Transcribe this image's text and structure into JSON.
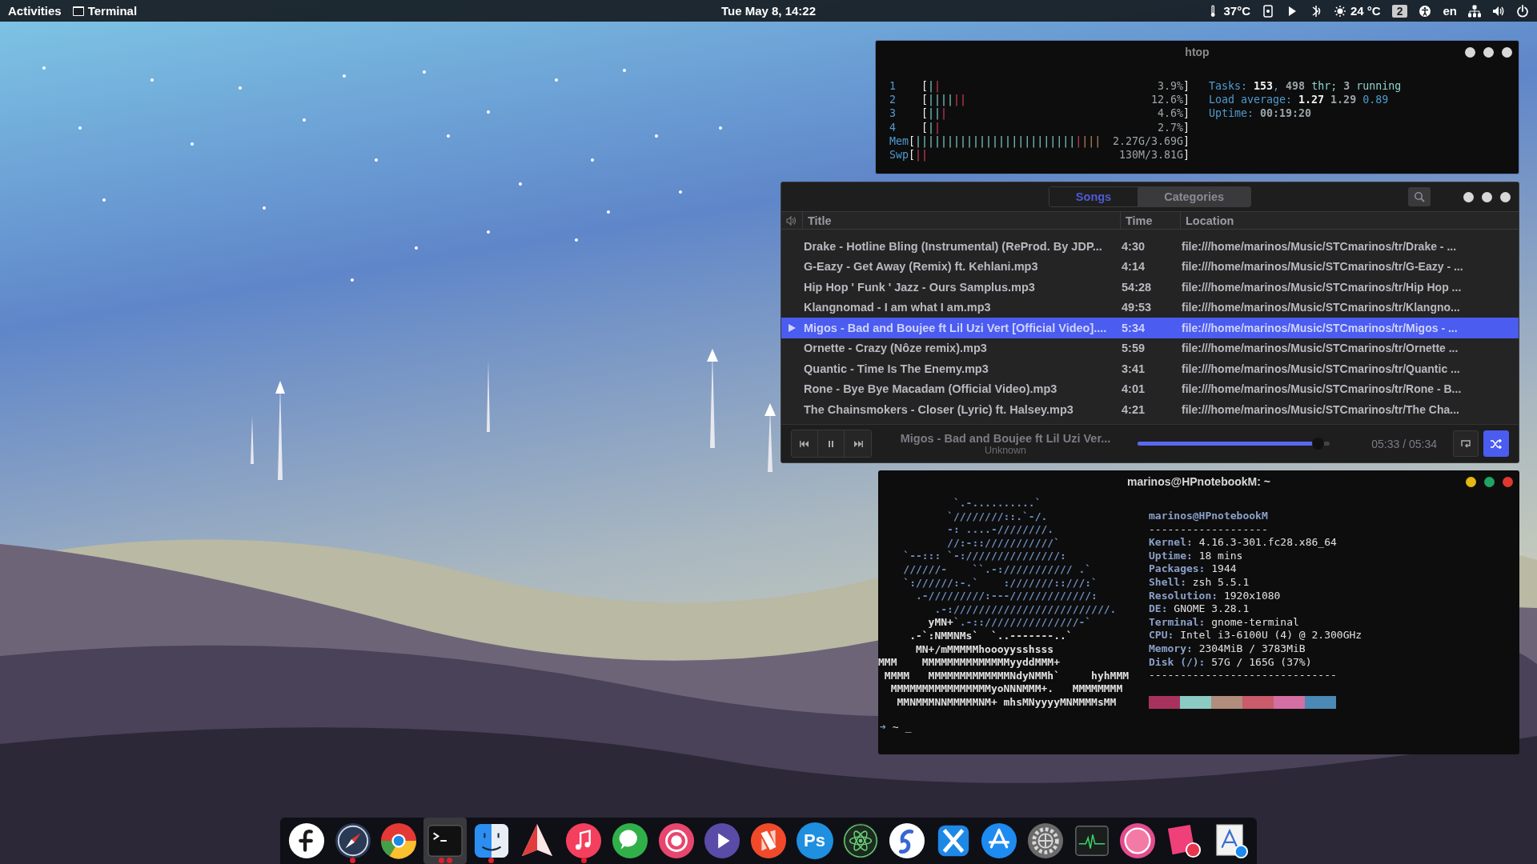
{
  "top_bar": {
    "activities": "Activities",
    "app_menu": "Terminal",
    "clock": "Tue May 8, 14:22",
    "indicators": [
      {
        "kind": "thermometer",
        "text": "37°C"
      },
      {
        "kind": "phone"
      },
      {
        "kind": "play"
      },
      {
        "kind": "signal"
      },
      {
        "kind": "weather",
        "text": "24 °C"
      },
      {
        "kind": "workspace",
        "text": "2"
      },
      {
        "kind": "accessibility"
      },
      {
        "kind": "language",
        "text": "en"
      },
      {
        "kind": "network"
      },
      {
        "kind": "volume"
      },
      {
        "kind": "power"
      }
    ]
  },
  "htop": {
    "title": "htop",
    "controls": [
      {
        "color": "#d8d8d8"
      },
      {
        "color": "#d8d8d8"
      },
      {
        "color": "#d8d8d8"
      }
    ],
    "meters": [
      {
        "label": "1",
        "open": "[",
        "bars": [
          {
            "kind": "normal",
            "text": "|"
          },
          {
            "kind": "kernel",
            "text": "|"
          }
        ],
        "value": "3.9%",
        "close": "]"
      },
      {
        "label": "2",
        "open": "[",
        "bars": [
          {
            "kind": "normal",
            "text": "||||"
          },
          {
            "kind": "kernel",
            "text": "||"
          }
        ],
        "value": "12.6%",
        "close": "]"
      },
      {
        "label": "3",
        "open": "[",
        "bars": [
          {
            "kind": "normal",
            "text": "||"
          },
          {
            "kind": "kernel",
            "text": "|"
          }
        ],
        "value": "4.6%",
        "close": "]"
      },
      {
        "label": "4",
        "open": "[",
        "bars": [
          {
            "kind": "normal",
            "text": "|"
          },
          {
            "kind": "kernel",
            "text": "|"
          }
        ],
        "value": "2.7%",
        "close": "]"
      },
      {
        "label": "Mem",
        "open": "[",
        "bars": [
          {
            "kind": "normal",
            "text": "|||||||||||||||||||||||||"
          },
          {
            "kind": "kernel",
            "text": "|"
          },
          {
            "kind": "cache",
            "text": "|||"
          }
        ],
        "value": "2.27G/3.69G",
        "close": "]"
      },
      {
        "label": "Swp",
        "open": "[",
        "bars": [
          {
            "kind": "kernel",
            "text": "||"
          }
        ],
        "value": "130M/3.81G",
        "close": "]"
      }
    ],
    "summary": [
      [
        {
          "kind": "label",
          "text": "Tasks: "
        },
        {
          "kind": "bright",
          "text": "153"
        },
        {
          "kind": "label",
          "text": ", "
        },
        {
          "kind": "dim",
          "text": "498"
        },
        {
          "kind": "accent",
          "text": " thr; "
        },
        {
          "kind": "dim",
          "text": "3"
        },
        {
          "kind": "accent",
          "text": " running"
        }
      ],
      [
        {
          "kind": "label",
          "text": "Load average: "
        },
        {
          "kind": "bright",
          "text": "1.27 "
        },
        {
          "kind": "dim",
          "text": "1.29 "
        },
        {
          "kind": "label",
          "text": "0.89"
        }
      ],
      [
        {
          "kind": "label",
          "text": "Uptime: "
        },
        {
          "kind": "dim",
          "text": "00:19:20"
        }
      ]
    ]
  },
  "music": {
    "tabs": [
      {
        "label": "Songs",
        "selected": true
      },
      {
        "label": "Categories",
        "selected": false
      }
    ],
    "controls": [
      {
        "color": "#d8d8d8"
      },
      {
        "color": "#d8d8d8"
      },
      {
        "color": "#d8d8d8"
      }
    ],
    "columns": [
      "Title",
      "Time",
      "Location"
    ],
    "rows": [
      {
        "title": "Drake - Hotline Bling (Instrumental) (ReProd. By JDP...",
        "time": "4:30",
        "location": "file:///home/marinos/Music/STCmarinos/tr/Drake - ...",
        "selected": false
      },
      {
        "title": "G-Eazy - Get Away (Remix) ft. Kehlani.mp3",
        "time": "4:14",
        "location": "file:///home/marinos/Music/STCmarinos/tr/G-Eazy - ...",
        "selected": false
      },
      {
        "title": "Hip Hop ' Funk ' Jazz - Ours Samplus.mp3",
        "time": "54:28",
        "location": "file:///home/marinos/Music/STCmarinos/tr/Hip Hop ...",
        "selected": false
      },
      {
        "title": "Klangnomad - I am what I am.mp3",
        "time": "49:53",
        "location": "file:///home/marinos/Music/STCmarinos/tr/Klangno...",
        "selected": false
      },
      {
        "title": "Migos - Bad and Boujee ft Lil Uzi Vert [Official Video]....",
        "time": "5:34",
        "location": "file:///home/marinos/Music/STCmarinos/tr/Migos - ...",
        "selected": true
      },
      {
        "title": "Ornette - Crazy (Nôze remix).mp3",
        "time": "5:59",
        "location": "file:///home/marinos/Music/STCmarinos/tr/Ornette ...",
        "selected": false
      },
      {
        "title": "Quantic - Time Is The Enemy.mp3",
        "time": "3:41",
        "location": "file:///home/marinos/Music/STCmarinos/tr/Quantic ...",
        "selected": false
      },
      {
        "title": "Rone - Bye Bye Macadam (Official Video).mp3",
        "time": "4:01",
        "location": "file:///home/marinos/Music/STCmarinos/tr/Rone - B...",
        "selected": false
      },
      {
        "title": "The Chainsmokers - Closer (Lyric) ft. Halsey.mp3",
        "time": "4:21",
        "location": "file:///home/marinos/Music/STCmarinos/tr/The Cha...",
        "selected": false
      }
    ],
    "now_playing": {
      "title": "Migos - Bad and Boujee ft Lil Uzi Ver...",
      "artist": "Unknown",
      "level": 0.97,
      "time": "05:33 / 05:34"
    },
    "repeat": {
      "on": false
    },
    "shuffle": {
      "on": true
    }
  },
  "terminal": {
    "title": "marinos@HPnotebookM: ~",
    "controls": [
      {
        "color": "#e5b711"
      },
      {
        "color": "#1fa463"
      },
      {
        "color": "#e0382f"
      }
    ],
    "art": [
      [
        {
          "kind": "logo",
          "text": "            `.-..........`"
        }
      ],
      [
        {
          "kind": "logo",
          "text": "           `////////::.`-/."
        }
      ],
      [
        {
          "kind": "logo",
          "text": "           -: ....-////////."
        }
      ],
      [
        {
          "kind": "logo",
          "text": "           //:-::///////////`"
        }
      ],
      [
        {
          "kind": "logo",
          "text": "    `--::: `-:///////////////:"
        }
      ],
      [
        {
          "kind": "logo",
          "text": "    //////-    ``.-://///////// .`"
        }
      ],
      [
        {
          "kind": "logo",
          "text": "    `://////:-.`    :///////::///:`"
        }
      ],
      [
        {
          "kind": "logo",
          "text": "      .-/////////:---/////////////:"
        }
      ],
      [
        {
          "kind": "logo",
          "text": "         .-://///////////////////////."
        }
      ],
      [
        {
          "kind": "plain",
          "text": "        yMN+"
        },
        {
          "kind": "logo",
          "text": "`.-::///////////////-`"
        }
      ],
      [
        {
          "kind": "plain",
          "text": "     .-`:NMMNMs`  `..-------..`"
        }
      ],
      [
        {
          "kind": "plain",
          "text": "      MN+/mMMMMMhoooyysshsss"
        }
      ],
      [
        {
          "kind": "plain",
          "text": "MMM    MMMMMMMMMMMMMMyyddMMM+"
        }
      ],
      [
        {
          "kind": "plain",
          "text": " MMMM   MMMMMMMMMMMMMNdyNMMh`     hyhMMM"
        }
      ],
      [
        {
          "kind": "plain",
          "text": "  MMMMMMMMMMMMMMMMyoNNNMMM+.   MMMMMMMM"
        }
      ],
      [
        {
          "kind": "plain",
          "text": "   MMNMMMNNMMMMMNM+ mhsMNyyyyMNMMMMsMM"
        }
      ]
    ],
    "user": "marinos@HPnotebookM",
    "rule": "-------------------",
    "info": [
      {
        "key": "Kernel:",
        "value": "4.16.3-301.fc28.x86_64"
      },
      {
        "key": "Uptime:",
        "value": "18 mins"
      },
      {
        "key": "Packages:",
        "value": "1944"
      },
      {
        "key": "Shell:",
        "value": "zsh 5.5.1"
      },
      {
        "key": "Resolution:",
        "value": "1920x1080"
      },
      {
        "key": "DE:",
        "value": "GNOME 3.28.1"
      },
      {
        "key": "Terminal:",
        "value": "gnome-terminal"
      },
      {
        "key": "CPU:",
        "value": "Intel i3-6100U (4) @ 2.300GHz"
      },
      {
        "key": "Memory:",
        "value": "2304MiB / 3783MiB"
      },
      {
        "key": "Disk (/):",
        "value": "57G / 165G (37%)"
      }
    ],
    "rule2": "------------------------------",
    "palette": [
      {
        "color": "#a8325e"
      },
      {
        "color": "#8ccac4"
      },
      {
        "color": "#b08d7d"
      },
      {
        "color": "#c95b6a"
      },
      {
        "color": "#d36fa3"
      },
      {
        "color": "#4a8ab5"
      }
    ],
    "prompt": {
      "arrow": "➜",
      "path": "~",
      "cursor": "_"
    }
  },
  "dock": [
    {
      "kind": "fedora",
      "selected": false,
      "running": false,
      "multi_window": false
    },
    {
      "kind": "compass",
      "selected": false,
      "running": true,
      "multi_window": false
    },
    {
      "kind": "chrome",
      "selected": false,
      "running": false,
      "multi_window": false
    },
    {
      "kind": "terminal",
      "selected": true,
      "running": true,
      "multi_window": true
    },
    {
      "kind": "finder",
      "selected": false,
      "running": true,
      "multi_window": false
    },
    {
      "kind": "plane",
      "selected": false,
      "running": false,
      "multi_window": false
    },
    {
      "kind": "music",
      "selected": false,
      "running": true,
      "multi_window": false
    },
    {
      "kind": "chat",
      "selected": false,
      "running": false,
      "multi_window": false
    },
    {
      "kind": "camera",
      "selected": false,
      "running": false,
      "multi_window": false
    },
    {
      "kind": "play",
      "selected": false,
      "running": false,
      "multi_window": false
    },
    {
      "kind": "news",
      "selected": false,
      "running": false,
      "multi_window": false
    },
    {
      "kind": "photoshop",
      "glyph": "Ps",
      "selected": false,
      "running": false,
      "multi_window": false
    },
    {
      "kind": "atom",
      "selected": false,
      "running": false,
      "multi_window": false
    },
    {
      "kind": "simplenote",
      "selected": false,
      "running": false,
      "multi_window": false
    },
    {
      "kind": "xcode",
      "selected": false,
      "running": false,
      "multi_window": false
    },
    {
      "kind": "appstore",
      "selected": false,
      "running": false,
      "multi_window": false
    },
    {
      "kind": "gear",
      "selected": false,
      "running": false,
      "multi_window": false
    },
    {
      "kind": "monitor",
      "selected": false,
      "running": false,
      "multi_window": false
    },
    {
      "kind": "orb",
      "selected": false,
      "running": false,
      "multi_window": false
    },
    {
      "kind": "shapes",
      "selected": false,
      "running": false,
      "multi_window": false
    },
    {
      "kind": "preview",
      "selected": false,
      "running": false,
      "multi_window": false
    }
  ]
}
